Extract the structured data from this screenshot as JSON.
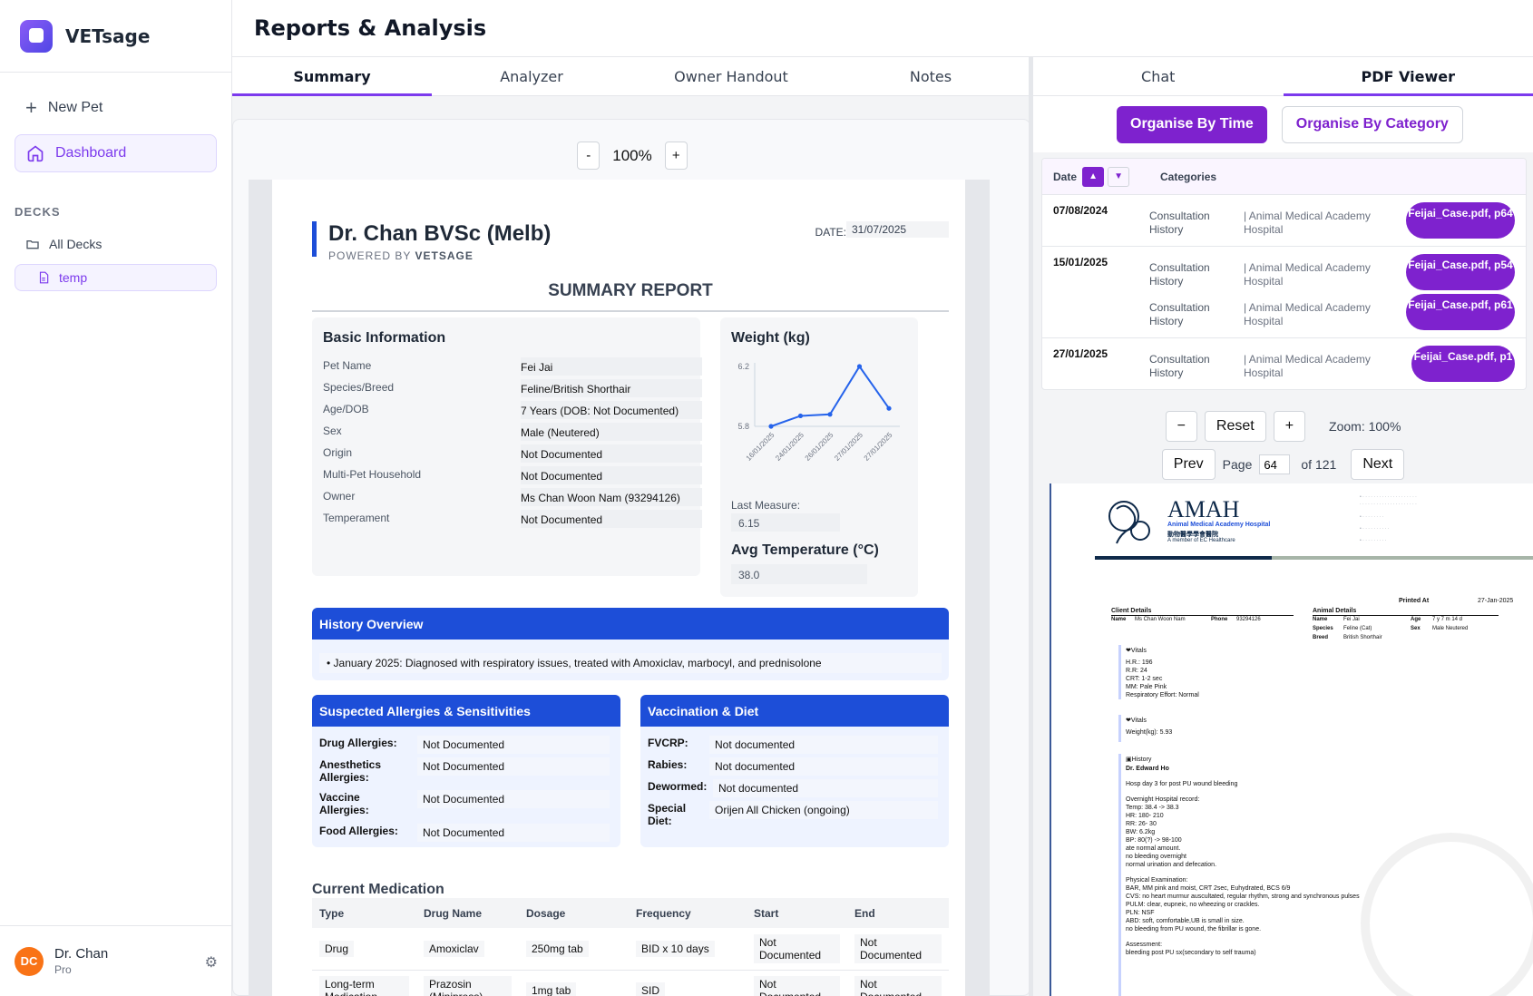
{
  "app": {
    "name": "VETsage"
  },
  "sidebar": {
    "new_pet": "New Pet",
    "dashboard": "Dashboard",
    "decks_label": "DECKS",
    "all_decks": "All Decks",
    "temp": "temp"
  },
  "user": {
    "initials": "DC",
    "name": "Dr. Chan",
    "plan": "Pro"
  },
  "header": {
    "title": "Reports & Analysis"
  },
  "left_tabs": [
    "Summary",
    "Analyzer",
    "Owner Handout",
    "Notes"
  ],
  "right_tabs": [
    "Chat",
    "PDF Viewer"
  ],
  "report_zoom": {
    "minus": "-",
    "value": "100%",
    "plus": "+"
  },
  "report": {
    "doctor": "Dr. Chan BVSc (Melb)",
    "powered_prefix": "POWERED BY",
    "powered_brand": "VETSAGE",
    "date_label": "DATE:",
    "date_value": "31/07/2025",
    "title": "SUMMARY REPORT",
    "basic_info": {
      "heading": "Basic Information",
      "rows": [
        {
          "label": "Pet Name",
          "value": "Fei Jai"
        },
        {
          "label": "Species/Breed",
          "value": "Feline/British Shorthair"
        },
        {
          "label": "Age/DOB",
          "value": "7 Years (DOB: Not Documented)"
        },
        {
          "label": "Sex",
          "value": "Male (Neutered)"
        },
        {
          "label": "Origin",
          "value": "Not Documented"
        },
        {
          "label": "Multi-Pet Household",
          "value": "Not Documented"
        },
        {
          "label": "Owner",
          "value": "Ms Chan Woon Nam (93294126)"
        },
        {
          "label": "Temperament",
          "value": "Not Documented"
        }
      ]
    },
    "weight": {
      "heading": "Weight (kg)",
      "last_label": "Last Measure:",
      "last_value": "6.15"
    },
    "temperature": {
      "heading": "Avg Temperature (°C)",
      "value": "38.0"
    },
    "history": {
      "heading": "History Overview",
      "items": [
        "January 2025: Diagnosed with respiratory issues, treated with Amoxiclav, marbocyl, and prednisolone"
      ]
    },
    "allergies": {
      "heading": "Suspected Allergies & Sensitivities",
      "rows": [
        {
          "label": "Drug Allergies:",
          "value": "Not Documented"
        },
        {
          "label": "Anesthetics Allergies:",
          "value": "Not Documented"
        },
        {
          "label": "Vaccine Allergies:",
          "value": "Not Documented"
        },
        {
          "label": "Food Allergies:",
          "value": "Not Documented"
        }
      ]
    },
    "vaccination": {
      "heading": "Vaccination & Diet",
      "rows": [
        {
          "label": "FVCRP:",
          "value": "Not documented"
        },
        {
          "label": "Rabies:",
          "value": "Not documented"
        },
        {
          "label": "Dewormed:",
          "value": "Not documented"
        },
        {
          "label": "Special Diet:",
          "value": "Orijen All Chicken (ongoing)"
        }
      ]
    },
    "medication": {
      "heading": "Current Medication",
      "columns": [
        "Type",
        "Drug Name",
        "Dosage",
        "Frequency",
        "Start",
        "End"
      ],
      "rows": [
        [
          "Drug",
          "Amoxiclav",
          "250mg tab",
          "BID x 10 days",
          "Not Documented",
          "Not Documented"
        ],
        [
          "Long-term Medication",
          "Prazosin (Minipress)",
          "1mg tab",
          "SID",
          "Not Documented",
          "Not Documented"
        ]
      ]
    }
  },
  "chart_data": {
    "type": "line",
    "title": "Weight (kg)",
    "x": [
      "16/01/2025",
      "24/01/2025",
      "26/01/2025",
      "27/01/2025",
      "27/01/2025"
    ],
    "values": [
      5.8,
      5.87,
      5.88,
      6.2,
      5.92
    ],
    "y_ticks": [
      "6.2",
      "5.8"
    ],
    "ylim": [
      5.8,
      6.2
    ],
    "color": "#2563eb"
  },
  "pdf_panel": {
    "organise_time": "Organise By Time",
    "organise_category": "Organise By Category",
    "date_header": "Date",
    "categories_header": "Categories",
    "rows": [
      {
        "date": "07/08/2024",
        "entries": [
          {
            "category": "Consultation History",
            "source": "| Animal Medical Academy Hospital",
            "file": "Feijai_Case.pdf, p64"
          }
        ]
      },
      {
        "date": "15/01/2025",
        "entries": [
          {
            "category": "Consultation History",
            "source": "| Animal Medical Academy Hospital",
            "file": "Feijai_Case.pdf, p54"
          },
          {
            "category": "Consultation History",
            "source": "| Animal Medical Academy Hospital",
            "file": "Feijai_Case.pdf, p61"
          }
        ]
      },
      {
        "date": "27/01/2025",
        "entries": [
          {
            "category": "Consultation History",
            "source": "| Animal Medical Academy Hospital",
            "file": "Feijai_Case.pdf, p1"
          }
        ]
      }
    ],
    "zoom_minus": "−",
    "reset": "Reset",
    "zoom_plus": "+",
    "zoom_label": "Zoom: 100%",
    "prev": "Prev",
    "page_label": "Page",
    "page_value": "64",
    "of_label": "of 121",
    "next": "Next"
  },
  "pdf_doc": {
    "logo": "AMAH",
    "sub1": "Animal Medical Academy Hospital",
    "sub2": "動物醫學學會醫院",
    "sub3": "A member of EC Healthcare",
    "printed_at_label": "Printed At",
    "printed_at_value": "27-Jan-2025",
    "client_details": "Client Details",
    "name_label": "Name",
    "name_value": "Ms Chan Woon Nam",
    "phone_label": "Phone",
    "phone_value": "93294126",
    "animal_details": "Animal Details",
    "animal_name_value": "Fei Jai",
    "age_label": "Age",
    "age_value": "7 y 7 m 14 d",
    "species_label": "Species",
    "species_value": "Feline (Cat)",
    "sex_label": "Sex",
    "sex_value": "Male Neutered",
    "breed_label": "Breed",
    "breed_value": "British Shorthair",
    "vitals1": [
      "Vitals",
      "H.R.: 196",
      "R.R: 24",
      "CRT: 1-2 sec",
      "MM: Pale Pink",
      "Respiratory Effort: Normal"
    ],
    "vitals2": [
      "Vitals",
      "Weight(kg): 5.93"
    ],
    "history": [
      "History",
      "Dr. Edward Ho",
      "Hosp day 3 for post PU wound bleeding",
      "Overnight Hospital record:",
      "Temp: 38.4 -> 38.3",
      "HR: 180- 210",
      "RR: 26- 30",
      "BW: 6.2kg",
      "BP: 80(?) -> 98-100",
      "ate normal amount.",
      "no bleeding overnight",
      "normal urination and defecation.",
      "Physical Examination:",
      "BAR, MM pink and moist, CRT 2sec, Euhydrated, BCS 6/9",
      "CVS: no heart murmur auscultated, regular rhythm, strong and synchronous pulses",
      "PULM: clear, eupneic, no wheezing or crackles.",
      "PLN: NSF",
      "ABD: soft, comfortable,UB is small in size.",
      "no bleeding from PU wound, the fibrillar is gone.",
      "Assessment:",
      "bleeding post PU sx(secondary to self trauma)"
    ]
  }
}
